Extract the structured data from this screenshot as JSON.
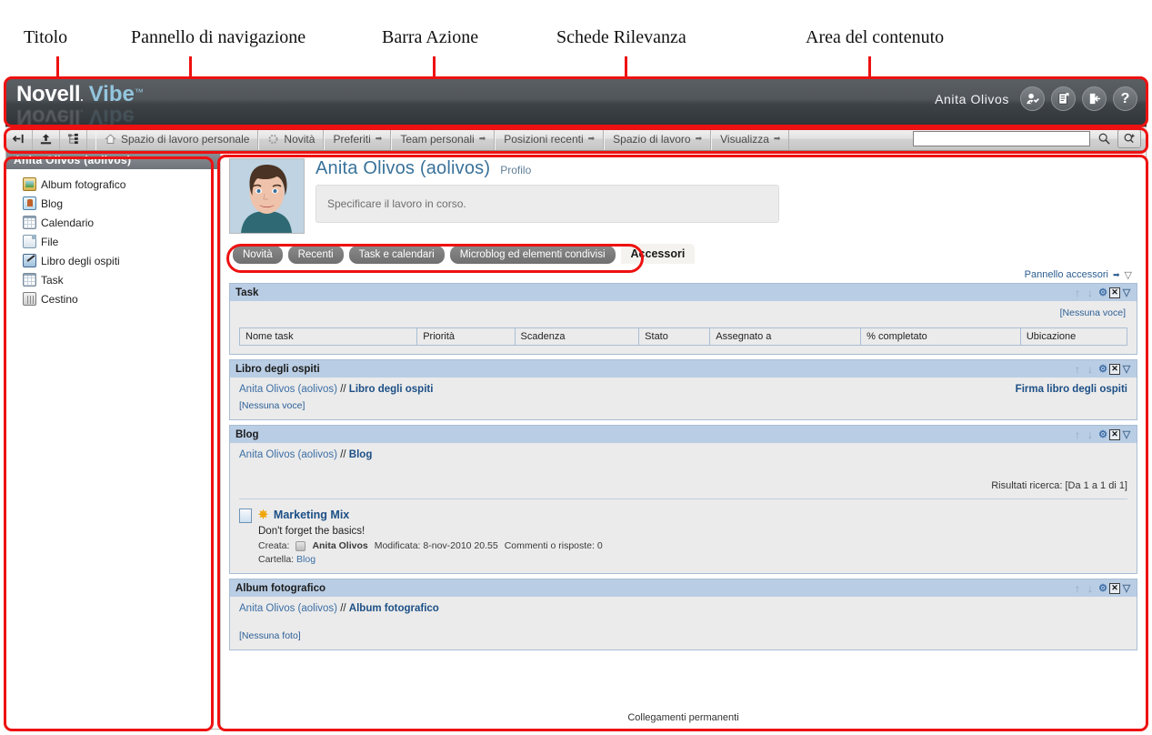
{
  "annotations": [
    {
      "label": "Titolo"
    },
    {
      "label": "Pannello di navigazione"
    },
    {
      "label": "Barra Azione"
    },
    {
      "label": "Schede Rilevanza"
    },
    {
      "label": "Area del contenuto"
    }
  ],
  "header": {
    "logo_main": "Novell",
    "logo_registered": ".",
    "logo_product": "Vibe",
    "logo_tm": "™",
    "user_name": "Anita Olivos",
    "icons": [
      {
        "name": "user-profile-icon",
        "glyph": "⚬"
      },
      {
        "name": "clipboard-icon",
        "glyph": "❐"
      },
      {
        "name": "logout-icon",
        "glyph": "⇤"
      },
      {
        "name": "help-icon",
        "glyph": "?"
      }
    ]
  },
  "actionbar": {
    "buttons": [
      {
        "name": "back-button",
        "glyph": "⇤"
      },
      {
        "name": "upload-button",
        "glyph": "↑"
      },
      {
        "name": "tree-button",
        "glyph": "⊞"
      }
    ],
    "items": [
      {
        "label": "Spazio di lavoro personale",
        "icon": "home-icon",
        "caret": false
      },
      {
        "label": "Novità",
        "icon": "refresh-icon",
        "caret": false
      },
      {
        "label": "Preferiti",
        "icon": "",
        "caret": true
      },
      {
        "label": "Team personali",
        "icon": "",
        "caret": true
      },
      {
        "label": "Posizioni recenti",
        "icon": "",
        "caret": true
      },
      {
        "label": "Spazio di lavoro",
        "icon": "",
        "caret": true
      },
      {
        "label": "Visualizza",
        "icon": "",
        "caret": true
      }
    ],
    "search": {
      "value": "",
      "placeholder": ""
    }
  },
  "sidebar": {
    "title": "Anita Olivos (aolivos)",
    "items": [
      {
        "label": "Album fotografico",
        "icon": "photo-album-icon"
      },
      {
        "label": "Blog",
        "icon": "blog-icon"
      },
      {
        "label": "Calendario",
        "icon": "calendar-icon"
      },
      {
        "label": "File",
        "icon": "file-icon"
      },
      {
        "label": "Libro degli ospiti",
        "icon": "guestbook-icon"
      },
      {
        "label": "Task",
        "icon": "task-icon"
      },
      {
        "label": "Cestino",
        "icon": "trash-icon"
      }
    ]
  },
  "profile": {
    "name": "Anita Olivos (aolivos)",
    "link": "Profilo",
    "status_placeholder": "Specificare il lavoro in corso."
  },
  "tabs": [
    {
      "label": "Novità",
      "active": false
    },
    {
      "label": "Recenti",
      "active": false
    },
    {
      "label": "Task e calendari",
      "active": false
    },
    {
      "label": "Microblog ed elementi condivisi",
      "active": false
    },
    {
      "label": "Accessori",
      "active": true
    }
  ],
  "accessory_panel_link": "Pannello accessori",
  "panels": {
    "task": {
      "title": "Task",
      "empty": "[Nessuna voce]",
      "columns": [
        "Nome task",
        "Priorità",
        "Scadenza",
        "Stato",
        "Assegnato a",
        "% completato",
        "Ubicazione"
      ]
    },
    "guestbook": {
      "title": "Libro degli ospiti",
      "crumb_owner": "Anita Olivos (aolivos)",
      "crumb_sep": " // ",
      "crumb_current": "Libro degli ospiti",
      "action": "Firma libro degli ospiti",
      "empty": "[Nessuna voce]"
    },
    "blog": {
      "title": "Blog",
      "crumb_owner": "Anita Olivos (aolivos)",
      "crumb_sep": " // ",
      "crumb_current": "Blog",
      "results": "Risultati ricerca: [Da 1 a 1 di 1]",
      "entry": {
        "title": "Marketing Mix",
        "description": "Don't forget the basics!",
        "created_label": "Creata:",
        "author": "Anita Olivos",
        "modified": "Modificata: 8-nov-2010 20.55",
        "comments": "Commenti o risposte: 0",
        "folder_label": "Cartella:",
        "folder": "Blog"
      }
    },
    "photoalbum": {
      "title": "Album fotografico",
      "crumb_owner": "Anita Olivos (aolivos)",
      "crumb_sep": " // ",
      "crumb_current": "Album fotografico",
      "empty": "[Nessuna foto]"
    }
  },
  "panel_controls": [
    {
      "name": "move-up-icon",
      "glyph": "↑"
    },
    {
      "name": "move-down-icon",
      "glyph": "↓"
    },
    {
      "name": "gear-icon",
      "glyph": "⚙"
    },
    {
      "name": "close-icon",
      "glyph": "✕"
    },
    {
      "name": "collapse-icon",
      "glyph": "▽"
    }
  ],
  "footer": "Collegamenti permanenti",
  "colors": {
    "accent_red": "#ee1111",
    "panel_header": "#b9cde4",
    "link_blue": "#3b6ea5",
    "titlebar": "#4a4f54"
  }
}
